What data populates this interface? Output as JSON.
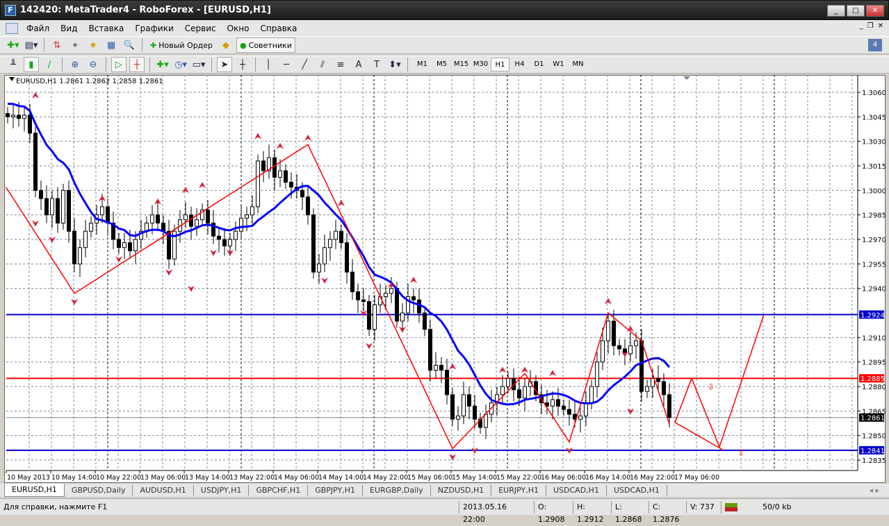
{
  "window": {
    "title": "142420: MetaTrader4 - RoboForex - [EURUSD,H1]",
    "minimize": "_",
    "maximize": "□",
    "close": "✕"
  },
  "menu": [
    "Файл",
    "Вид",
    "Вставка",
    "Графики",
    "Сервис",
    "Окно",
    "Справка"
  ],
  "mdi": {
    "minimize": "_",
    "restore": "❐",
    "close": "✕"
  },
  "toolbar": {
    "new_order": "Новый Ордер",
    "experts": "Советники",
    "notice_count": "4"
  },
  "timeframes": [
    "M1",
    "M5",
    "M15",
    "M30",
    "H1",
    "H4",
    "D1",
    "W1",
    "MN"
  ],
  "active_timeframe": "H1",
  "chart_data": {
    "type": "candlestick",
    "header": "EURUSD,H1  1.2861 1.2862 1.2858 1.2861",
    "symbol": "EURUSD",
    "period": "H1",
    "ylim": [
      1.283,
      1.3076
    ],
    "yticks": [
      "1.3060",
      "1.3045",
      "1.3030",
      "1.3015",
      "1.3000",
      "1.2985",
      "1.2970",
      "1.2955",
      "1.2940",
      "1.2910",
      "1.2895",
      "1.2880",
      "1.2865",
      "1.2850",
      "1.2835"
    ],
    "xticks": [
      "10 May 2013",
      "10 May 14:00",
      "10 May 22:00",
      "13 May 06:00",
      "13 May 14:00",
      "13 May 22:00",
      "14 May 06:00",
      "14 May 14:00",
      "14 May 22:00",
      "15 May 06:00",
      "15 May 14:00",
      "15 May 22:00",
      "16 May 06:00",
      "16 May 14:00",
      "16 May 22:00",
      "17 May 06:00"
    ],
    "close": [
      1.3045,
      1.3046,
      1.3044,
      1.3046,
      1.3035,
      1.3,
      1.2995,
      1.2985,
      1.2995,
      1.298,
      1.3,
      1.2975,
      1.2955,
      1.2965,
      1.2975,
      1.298,
      1.2985,
      1.299,
      1.298,
      1.297,
      1.2965,
      1.2968,
      1.2963,
      1.297,
      1.2975,
      1.298,
      1.2985,
      1.298,
      1.2975,
      1.2958,
      1.2975,
      1.2982,
      1.2985,
      1.2978,
      1.2982,
      1.2988,
      1.298,
      1.2972,
      1.297,
      1.2966,
      1.297,
      1.2975,
      1.2983,
      1.2985,
      1.299,
      1.3018,
      1.3012,
      1.302,
      1.3008,
      1.3012,
      1.3005,
      1.3002,
      1.3,
      1.2996,
      1.2985,
      1.295,
      1.2955,
      1.2965,
      1.297,
      1.2975,
      1.2968,
      1.295,
      1.2938,
      1.2933,
      1.2932,
      1.2915,
      1.293,
      1.2935,
      1.2937,
      1.294,
      1.292,
      1.2925,
      1.2935,
      1.2933,
      1.2925,
      1.2915,
      1.289,
      1.2893,
      1.289,
      1.2875,
      1.286,
      1.2862,
      1.2875,
      1.2868,
      1.286,
      1.2855,
      1.2863,
      1.287,
      1.2875,
      1.288,
      1.2885,
      1.2878,
      1.2873,
      1.288,
      1.2883,
      1.2875,
      1.287,
      1.2868,
      1.2872,
      1.2868,
      1.2866,
      1.2863,
      1.286,
      1.2862,
      1.287,
      1.288,
      1.2895,
      1.2908,
      1.292,
      1.2905,
      1.2903,
      1.29,
      1.2905,
      1.2908,
      1.2877,
      1.288,
      1.2885,
      1.2883,
      1.2875,
      1.2861
    ],
    "ma_period": 12,
    "zigzag": [
      [
        -0.3,
        1.3002
      ],
      [
        12,
        1.2937
      ],
      [
        54,
        1.3028
      ],
      [
        80,
        1.2842
      ],
      [
        93,
        1.2888
      ],
      [
        101,
        1.2846
      ],
      [
        108,
        1.2925
      ],
      [
        114,
        1.2908
      ],
      [
        119,
        1.2857
      ]
    ],
    "projection": [
      [
        [
          120,
          1.2858
        ],
        [
          123,
          1.2885
        ],
        [
          128,
          1.2843
        ],
        [
          136,
          1.2924
        ]
      ],
      [
        [
          120,
          1.2858
        ],
        [
          128.75,
          1.2841
        ]
      ]
    ],
    "fractals": [
      [
        5,
        1.3058,
        "up"
      ],
      [
        5,
        1.298,
        "down"
      ],
      [
        8,
        1.297,
        "down"
      ],
      [
        12,
        1.2932,
        "down"
      ],
      [
        17,
        1.2995,
        "up"
      ],
      [
        20,
        1.2958,
        "down"
      ],
      [
        27,
        1.2993,
        "up"
      ],
      [
        29,
        1.295,
        "down"
      ],
      [
        32,
        1.3,
        "up"
      ],
      [
        35,
        1.3003,
        "up"
      ],
      [
        33,
        1.294,
        "down"
      ],
      [
        37,
        1.2962,
        "down"
      ],
      [
        40,
        1.2962,
        "down"
      ],
      [
        45,
        1.3033,
        "up"
      ],
      [
        49,
        1.3027,
        "up"
      ],
      [
        54,
        1.3032,
        "up"
      ],
      [
        57,
        1.2945,
        "down"
      ],
      [
        60,
        1.2992,
        "up"
      ],
      [
        64,
        1.2925,
        "down"
      ],
      [
        65,
        1.2905,
        "down"
      ],
      [
        69,
        1.2942,
        "up"
      ],
      [
        71,
        1.2915,
        "down"
      ],
      [
        73,
        1.2945,
        "up"
      ],
      [
        80,
        1.2892,
        "up"
      ],
      [
        80,
        1.2837,
        "down"
      ],
      [
        84,
        1.2841,
        "down"
      ],
      [
        89,
        1.289,
        "up"
      ],
      [
        93,
        1.289,
        "up"
      ],
      [
        98,
        1.2888,
        "up"
      ],
      [
        101,
        1.2841,
        "down"
      ],
      [
        108,
        1.2932,
        "up"
      ],
      [
        111,
        1.29,
        "down"
      ],
      [
        112,
        1.2915,
        "up"
      ],
      [
        112,
        1.2865,
        "down"
      ]
    ],
    "hlines": [
      {
        "price": "1.2924",
        "color": "#0000cc"
      },
      {
        "price": "1.2885",
        "color": "#ff0000"
      },
      {
        "price": "1.2841",
        "color": "#0000cc"
      },
      {
        "price": "1.2861",
        "color": "#000000"
      }
    ]
  },
  "tabs": [
    "EURUSD,H1",
    "GBPUSD,Daily",
    "AUDUSD,H1",
    "USDJPY,H1",
    "GBPCHF,H1",
    "GBPJPY,H1",
    "EURGBP,Daily",
    "NZDUSD,H1",
    "EURJPY,H1",
    "USDCAD,H1",
    "USDCAD,H1"
  ],
  "status": {
    "help": "Для справки, нажмите F1",
    "time": "2013.05.16 22:00",
    "open": "O: 1.2908",
    "high": "H: 1.2912",
    "low": "L: 1.2868",
    "close": "C: 1.2876",
    "volume": "V: 737",
    "traffic": "50/0 kb"
  }
}
